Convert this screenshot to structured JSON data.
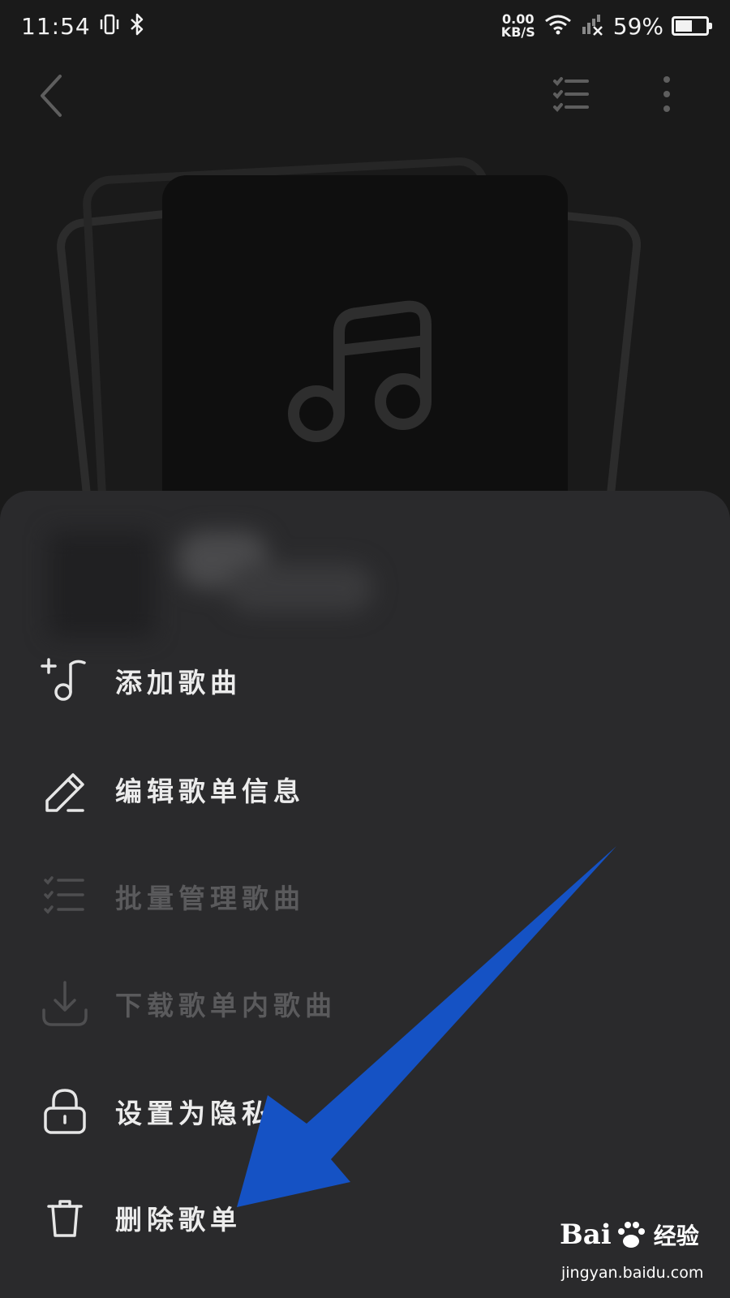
{
  "status_bar": {
    "time": "11:54",
    "net_speed_value": "0.00",
    "net_speed_unit": "KB/S",
    "battery_percent": "59%",
    "battery_level": 0.59
  },
  "icons": {
    "back": "chevron-left-icon",
    "multi_select": "checklist-icon",
    "more": "more-vertical-icon",
    "cover": "music-note-icon"
  },
  "menu": {
    "items": [
      {
        "label": "添加歌曲",
        "icon": "add-music-icon",
        "enabled": true
      },
      {
        "label": "编辑歌单信息",
        "icon": "edit-pencil-icon",
        "enabled": true
      },
      {
        "label": "批量管理歌曲",
        "icon": "checklist-icon",
        "enabled": false
      },
      {
        "label": "下载歌单内歌曲",
        "icon": "download-icon",
        "enabled": false
      },
      {
        "label": "设置为隐私",
        "icon": "lock-icon",
        "enabled": true
      },
      {
        "label": "删除歌单",
        "icon": "trash-icon",
        "enabled": true
      }
    ]
  },
  "watermark": {
    "brand_left": "Bai",
    "brand_right": "经验",
    "url": "jingyan.baidu.com"
  },
  "colors": {
    "background": "#1a1a1a",
    "sheet": "#2a2a2c",
    "text": "#ececec",
    "text_disabled": "#5a5a5c",
    "annotation_arrow": "#1552c4"
  }
}
